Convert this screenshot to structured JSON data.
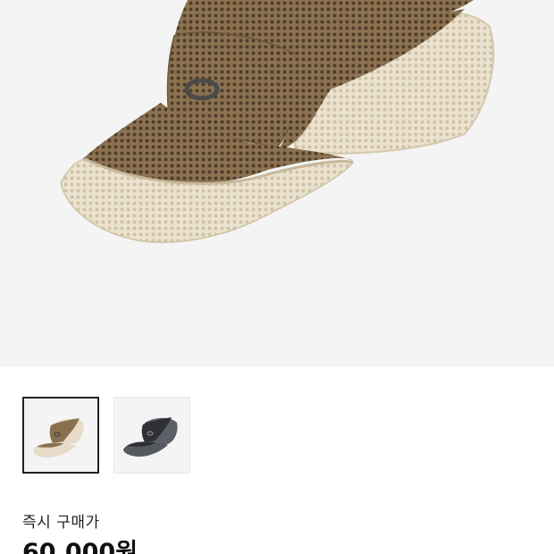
{
  "product": {
    "main_image": "mesh-five-panel-cap-tan-beige",
    "thumbnails": [
      {
        "name": "tan-beige-cap",
        "selected": true
      },
      {
        "name": "charcoal-grey-cap",
        "selected": false
      }
    ]
  },
  "price": {
    "label": "즉시 구매가",
    "value": "60,000원"
  },
  "colors": {
    "background_gray": "#f4f4f4",
    "mesh_brown": "#8a6f4e",
    "mesh_beige": "#e6dcc8",
    "cap_dark": "#3b3d40",
    "text_primary": "#222222"
  }
}
